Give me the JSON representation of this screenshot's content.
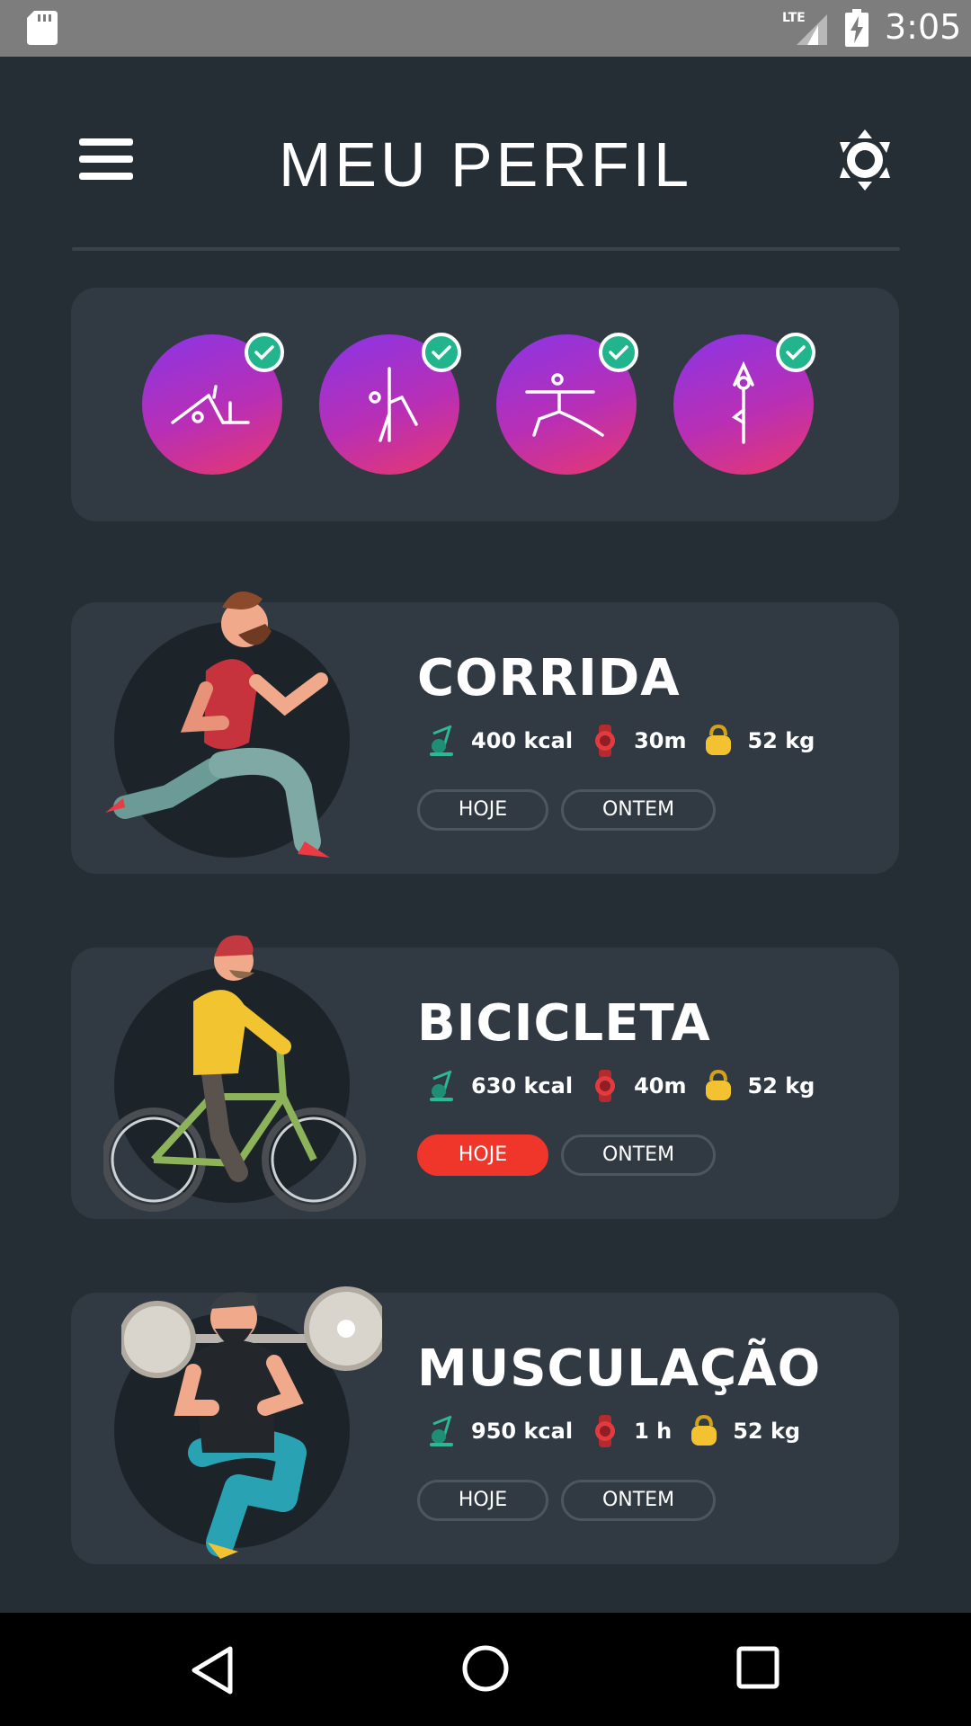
{
  "status_bar": {
    "time": "3:05",
    "network": "LTE"
  },
  "header": {
    "title": "MEU PERFIL"
  },
  "badges": [
    {
      "icon": "stretch-pose-icon",
      "completed": true
    },
    {
      "icon": "seated-pose-icon",
      "completed": true
    },
    {
      "icon": "lunge-pose-icon",
      "completed": true
    },
    {
      "icon": "tree-pose-icon",
      "completed": true
    }
  ],
  "activities": [
    {
      "title": "CORRIDA",
      "calories": "400 kcal",
      "duration": "30m",
      "weight": "52 kg",
      "today_label": "HOJE",
      "yesterday_label": "ONTEM",
      "today_active": false
    },
    {
      "title": "BICICLETA",
      "calories": "630 kcal",
      "duration": "40m",
      "weight": "52 kg",
      "today_label": "HOJE",
      "yesterday_label": "ONTEM",
      "today_active": true
    },
    {
      "title": "MUSCULAÇÃO",
      "calories": "950 kcal",
      "duration": "1 h",
      "weight": "52 kg",
      "today_label": "HOJE",
      "yesterday_label": "ONTEM",
      "today_active": false
    }
  ],
  "colors": {
    "background": "#262e35",
    "card": "#313a42",
    "accent_red": "#f0362a",
    "badge_gradient_start": "#8a35e6",
    "badge_gradient_end": "#e8386e",
    "check_green": "#22b58d"
  },
  "icons": {
    "menu": "hamburger-menu-icon",
    "settings": "brightness-icon",
    "calories": "exercise-bike-icon",
    "duration": "watch-icon",
    "weight": "kettlebell-icon"
  }
}
